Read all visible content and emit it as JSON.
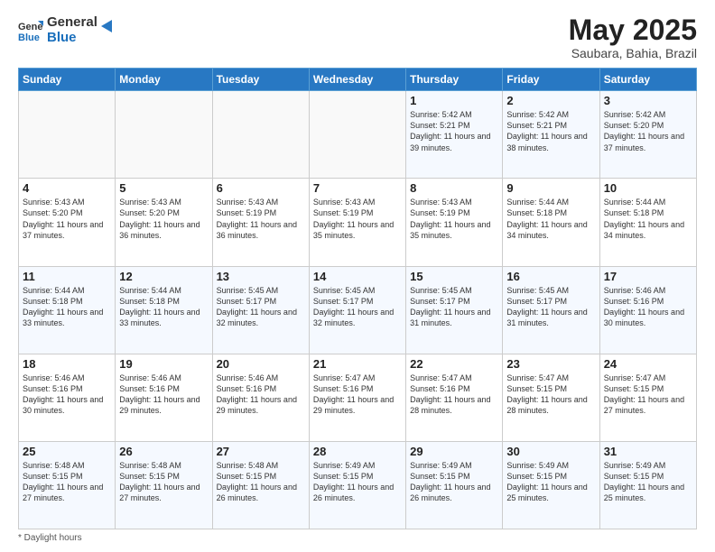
{
  "header": {
    "logo_general": "General",
    "logo_blue": "Blue",
    "month_title": "May 2025",
    "subtitle": "Saubara, Bahia, Brazil"
  },
  "days_of_week": [
    "Sunday",
    "Monday",
    "Tuesday",
    "Wednesday",
    "Thursday",
    "Friday",
    "Saturday"
  ],
  "weeks": [
    [
      {
        "day": "",
        "info": ""
      },
      {
        "day": "",
        "info": ""
      },
      {
        "day": "",
        "info": ""
      },
      {
        "day": "",
        "info": ""
      },
      {
        "day": "1",
        "info": "Sunrise: 5:42 AM\nSunset: 5:21 PM\nDaylight: 11 hours and 39 minutes."
      },
      {
        "day": "2",
        "info": "Sunrise: 5:42 AM\nSunset: 5:21 PM\nDaylight: 11 hours and 38 minutes."
      },
      {
        "day": "3",
        "info": "Sunrise: 5:42 AM\nSunset: 5:20 PM\nDaylight: 11 hours and 37 minutes."
      }
    ],
    [
      {
        "day": "4",
        "info": "Sunrise: 5:43 AM\nSunset: 5:20 PM\nDaylight: 11 hours and 37 minutes."
      },
      {
        "day": "5",
        "info": "Sunrise: 5:43 AM\nSunset: 5:20 PM\nDaylight: 11 hours and 36 minutes."
      },
      {
        "day": "6",
        "info": "Sunrise: 5:43 AM\nSunset: 5:19 PM\nDaylight: 11 hours and 36 minutes."
      },
      {
        "day": "7",
        "info": "Sunrise: 5:43 AM\nSunset: 5:19 PM\nDaylight: 11 hours and 35 minutes."
      },
      {
        "day": "8",
        "info": "Sunrise: 5:43 AM\nSunset: 5:19 PM\nDaylight: 11 hours and 35 minutes."
      },
      {
        "day": "9",
        "info": "Sunrise: 5:44 AM\nSunset: 5:18 PM\nDaylight: 11 hours and 34 minutes."
      },
      {
        "day": "10",
        "info": "Sunrise: 5:44 AM\nSunset: 5:18 PM\nDaylight: 11 hours and 34 minutes."
      }
    ],
    [
      {
        "day": "11",
        "info": "Sunrise: 5:44 AM\nSunset: 5:18 PM\nDaylight: 11 hours and 33 minutes."
      },
      {
        "day": "12",
        "info": "Sunrise: 5:44 AM\nSunset: 5:18 PM\nDaylight: 11 hours and 33 minutes."
      },
      {
        "day": "13",
        "info": "Sunrise: 5:45 AM\nSunset: 5:17 PM\nDaylight: 11 hours and 32 minutes."
      },
      {
        "day": "14",
        "info": "Sunrise: 5:45 AM\nSunset: 5:17 PM\nDaylight: 11 hours and 32 minutes."
      },
      {
        "day": "15",
        "info": "Sunrise: 5:45 AM\nSunset: 5:17 PM\nDaylight: 11 hours and 31 minutes."
      },
      {
        "day": "16",
        "info": "Sunrise: 5:45 AM\nSunset: 5:17 PM\nDaylight: 11 hours and 31 minutes."
      },
      {
        "day": "17",
        "info": "Sunrise: 5:46 AM\nSunset: 5:16 PM\nDaylight: 11 hours and 30 minutes."
      }
    ],
    [
      {
        "day": "18",
        "info": "Sunrise: 5:46 AM\nSunset: 5:16 PM\nDaylight: 11 hours and 30 minutes."
      },
      {
        "day": "19",
        "info": "Sunrise: 5:46 AM\nSunset: 5:16 PM\nDaylight: 11 hours and 29 minutes."
      },
      {
        "day": "20",
        "info": "Sunrise: 5:46 AM\nSunset: 5:16 PM\nDaylight: 11 hours and 29 minutes."
      },
      {
        "day": "21",
        "info": "Sunrise: 5:47 AM\nSunset: 5:16 PM\nDaylight: 11 hours and 29 minutes."
      },
      {
        "day": "22",
        "info": "Sunrise: 5:47 AM\nSunset: 5:16 PM\nDaylight: 11 hours and 28 minutes."
      },
      {
        "day": "23",
        "info": "Sunrise: 5:47 AM\nSunset: 5:15 PM\nDaylight: 11 hours and 28 minutes."
      },
      {
        "day": "24",
        "info": "Sunrise: 5:47 AM\nSunset: 5:15 PM\nDaylight: 11 hours and 27 minutes."
      }
    ],
    [
      {
        "day": "25",
        "info": "Sunrise: 5:48 AM\nSunset: 5:15 PM\nDaylight: 11 hours and 27 minutes."
      },
      {
        "day": "26",
        "info": "Sunrise: 5:48 AM\nSunset: 5:15 PM\nDaylight: 11 hours and 27 minutes."
      },
      {
        "day": "27",
        "info": "Sunrise: 5:48 AM\nSunset: 5:15 PM\nDaylight: 11 hours and 26 minutes."
      },
      {
        "day": "28",
        "info": "Sunrise: 5:49 AM\nSunset: 5:15 PM\nDaylight: 11 hours and 26 minutes."
      },
      {
        "day": "29",
        "info": "Sunrise: 5:49 AM\nSunset: 5:15 PM\nDaylight: 11 hours and 26 minutes."
      },
      {
        "day": "30",
        "info": "Sunrise: 5:49 AM\nSunset: 5:15 PM\nDaylight: 11 hours and 25 minutes."
      },
      {
        "day": "31",
        "info": "Sunrise: 5:49 AM\nSunset: 5:15 PM\nDaylight: 11 hours and 25 minutes."
      }
    ]
  ],
  "footer": {
    "note": "Daylight hours"
  }
}
